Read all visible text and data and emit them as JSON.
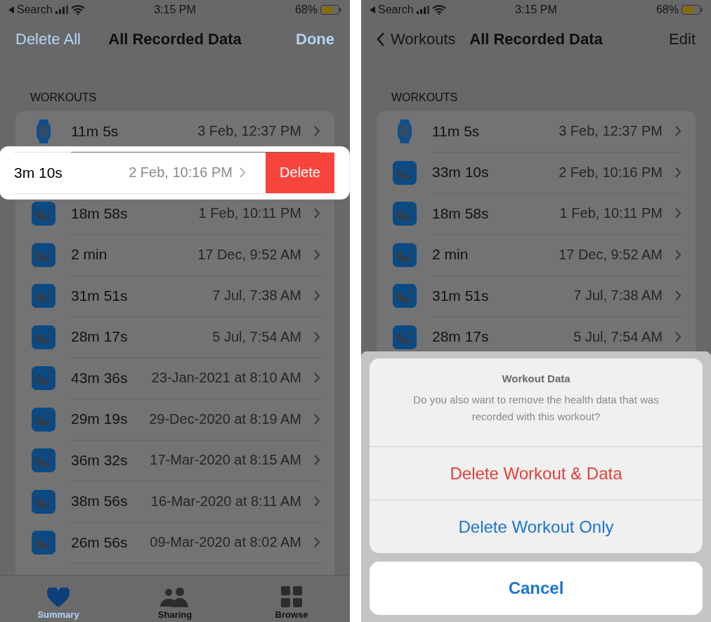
{
  "phones": [
    {
      "status": {
        "back_label": "Search",
        "time": "3:15 PM",
        "battery": "68%"
      },
      "nav": {
        "left": {
          "label": "Delete All",
          "kind": "text"
        },
        "title": "All Recorded Data",
        "right": {
          "label": "Done",
          "disabled": false
        }
      },
      "section": "WORKOUTS",
      "rows": [
        {
          "kind": "watch",
          "duration": "11m 5s",
          "date": "3 Feb, 12:37 PM",
          "swiped": false
        },
        {
          "duration": "3m 10s",
          "date": "2 Feb, 10:16 PM",
          "swiped": true,
          "action": "Delete"
        },
        {
          "kind": "shoe",
          "duration": "18m 58s",
          "date": "1 Feb, 10:11 PM",
          "swiped": false
        },
        {
          "kind": "shoe",
          "duration": "2 min",
          "date": "17 Dec, 9:52 AM",
          "swiped": false
        },
        {
          "kind": "shoe",
          "duration": "31m 51s",
          "date": "7 Jul, 7:38 AM",
          "swiped": false
        },
        {
          "kind": "shoe",
          "duration": "28m 17s",
          "date": "5 Jul, 7:54 AM",
          "swiped": false
        },
        {
          "kind": "shoe",
          "duration": "43m 36s",
          "date": "23-Jan-2021 at 8:10 AM",
          "swiped": false
        },
        {
          "kind": "shoe",
          "duration": "29m 19s",
          "date": "29-Dec-2020 at 8:19 AM",
          "swiped": false
        },
        {
          "kind": "shoe",
          "duration": "36m 32s",
          "date": "17-Mar-2020 at 8:15 AM",
          "swiped": false
        },
        {
          "kind": "shoe",
          "duration": "38m 56s",
          "date": "16-Mar-2020 at 8:11 AM",
          "swiped": false
        },
        {
          "kind": "shoe",
          "duration": "26m 56s",
          "date": "09-Mar-2020 at 8:02 AM",
          "swiped": false
        }
      ],
      "tab_bar": [
        {
          "kind": "heart",
          "label": "Summary",
          "selected": true
        },
        {
          "kind": "people",
          "label": "Sharing",
          "selected": false
        },
        {
          "kind": "grid",
          "label": "Browse",
          "selected": false
        }
      ]
    },
    {
      "status": {
        "back_label": "Search",
        "time": "3:15 PM",
        "battery": "68%"
      },
      "nav": {
        "left": {
          "label": "Workouts",
          "kind": "back"
        },
        "title": "All Recorded Data",
        "right": {
          "label": "Edit",
          "disabled": true
        }
      },
      "section": "WORKOUTS",
      "rows": [
        {
          "kind": "watch",
          "duration": "11m 5s",
          "date": "3 Feb, 12:37 PM",
          "swiped": false
        },
        {
          "kind": "shoe",
          "duration": "33m 10s",
          "date": "2 Feb, 10:16 PM",
          "swiped": false
        },
        {
          "kind": "shoe",
          "duration": "18m 58s",
          "date": "1 Feb, 10:11 PM",
          "swiped": false
        },
        {
          "kind": "shoe",
          "duration": "2 min",
          "date": "17 Dec, 9:52 AM",
          "swiped": false
        },
        {
          "kind": "shoe",
          "duration": "31m 51s",
          "date": "7 Jul, 7:38 AM",
          "swiped": false
        },
        {
          "kind": "shoe",
          "duration": "28m 17s",
          "date": "5 Jul, 7:54 AM",
          "swiped": false
        }
      ],
      "action_sheet": {
        "title": "Workout Data",
        "message": "Do you also want to remove the health data that was recorded with this workout?",
        "actions": [
          {
            "label": "Delete Workout & Data",
            "kind": "destructive"
          },
          {
            "label": "Delete Workout Only",
            "kind": "default"
          }
        ],
        "cancel": "Cancel"
      }
    }
  ]
}
